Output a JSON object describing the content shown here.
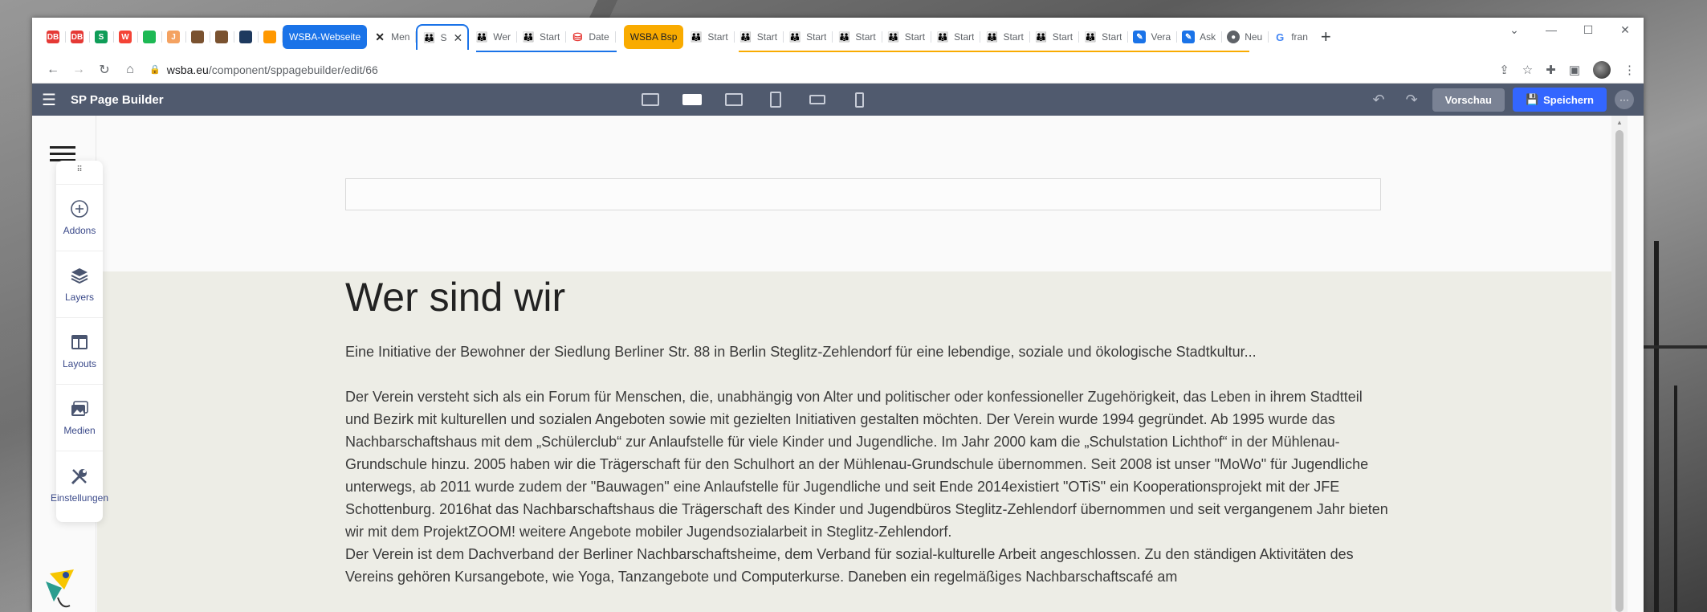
{
  "browser": {
    "tabs": [
      {
        "favicon_color": "#e53935",
        "favicon_text": "DB",
        "title": ""
      },
      {
        "favicon_color": "#e53935",
        "favicon_text": "DB",
        "title": ""
      },
      {
        "favicon_color": "#0f9d58",
        "favicon_text": "S",
        "title": ""
      },
      {
        "favicon_color": "#f44336",
        "favicon_text": "W",
        "title": ""
      },
      {
        "favicon_color": "#1db954",
        "favicon_text": "",
        "title": ""
      },
      {
        "favicon_color": "#f4a261",
        "favicon_text": "J",
        "title": ""
      },
      {
        "favicon_color": "#7a5230",
        "favicon_text": "",
        "title": ""
      },
      {
        "favicon_color": "#7a5230",
        "favicon_text": "",
        "title": ""
      },
      {
        "favicon_color": "#1e3a5f",
        "favicon_text": "",
        "title": ""
      },
      {
        "favicon_color": "#ff9800",
        "favicon_text": "",
        "title": ""
      }
    ],
    "group_blue": "WSBA-Webseite",
    "blue_tabs": [
      "Men",
      "S",
      "Wer",
      "Start",
      "Date"
    ],
    "group_orange": "WSBA Bsp",
    "orange_tabs": [
      "Start",
      "Start",
      "Start",
      "Start",
      "Start",
      "Start",
      "Start",
      "Start",
      "Start"
    ],
    "end_tabs": [
      "Vera",
      "Ask",
      "Neu",
      "fran"
    ],
    "address": {
      "host": "wsba.eu",
      "path": "/component/sppagebuilder/edit/66"
    }
  },
  "builder": {
    "brand": "SP Page Builder",
    "preview_label": "Vorschau",
    "save_label": "Speichern",
    "sidebar": [
      {
        "label": "Addons",
        "icon": "plus-circle-icon"
      },
      {
        "label": "Layers",
        "icon": "layers-icon"
      },
      {
        "label": "Layouts",
        "icon": "layout-icon"
      },
      {
        "label": "Medien",
        "icon": "media-icon"
      },
      {
        "label": "Einstellungen",
        "icon": "wrench-icon"
      }
    ]
  },
  "page": {
    "heading": "Wer sind wir",
    "intro": "Eine Initiative der Bewohner der Siedlung Berliner Str. 88 in Berlin Steglitz-Zehlendorf für eine lebendige, soziale und ökologische Stadtkultur...",
    "para1": "Der Verein versteht sich als ein Forum für Menschen, die, unabhängig von Alter und politischer oder konfessioneller Zugehörigkeit, das Leben in ihrem Stadtteil und Bezirk mit kulturellen und sozialen Angeboten sowie mit gezielten Initiativen gestalten möchten. Der Verein wurde 1994 gegründet. Ab 1995 wurde das Nachbarschaftshaus mit dem „Schülerclub“ zur Anlaufstelle für viele Kinder und Jugendliche. Im Jahr 2000 kam die „Schulstation Lichthof“ in der Mühlenau-Grundschule hinzu. 2005 haben wir die Trägerschaft für den Schulhort an der Mühlenau-Grundschule übernommen. Seit 2008 ist unser \"MoWo\" für Jugendliche unterwegs, ab 2011 wurde zudem der \"Bauwagen\" eine Anlaufstelle für Jugendliche und seit Ende 2014existiert \"OTiS\" ein Kooperationsprojekt mit der JFE Schottenburg. 2016hat das Nachbarschaftshaus die Trägerschaft des Kinder und Jugendbüros Steglitz-Zehlendorf übernommen und seit vergangenem Jahr bieten wir mit dem ProjektZOOM! weitere Angebote mobiler Jugendsozialarbeit in Steglitz-Zehlendorf.",
    "para2": "Der Verein ist dem Dachverband der Berliner Nachbarschaftsheime, dem Verband für sozial-kulturelle Arbeit angeschlossen. Zu den ständigen Aktivitäten des Vereins gehören Kursangebote, wie Yoga, Tanzangebote und Computerkurse. Daneben ein regelmäßiges Nachbarschaftscafé am"
  }
}
